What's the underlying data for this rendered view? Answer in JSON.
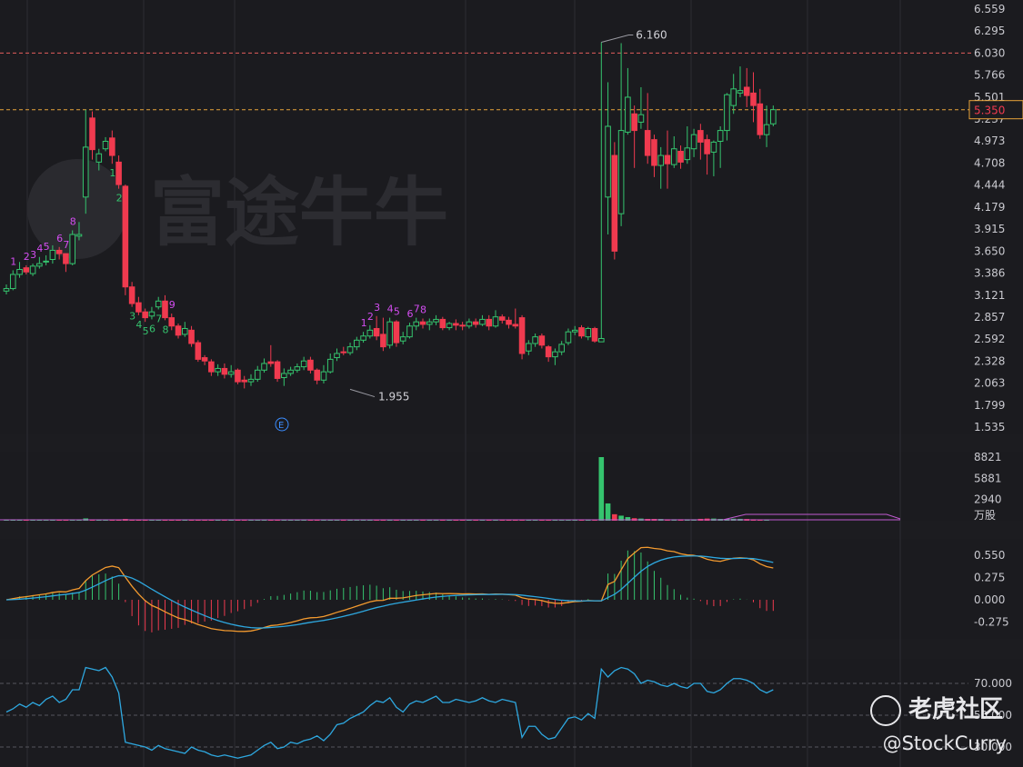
{
  "chart_data": {
    "type": "candlestick",
    "price_axis_ticks": [
      "6.559",
      "6.295",
      "6.030",
      "5.766",
      "5.501",
      "5.237",
      "4.973",
      "4.708",
      "4.444",
      "4.179",
      "3.915",
      "3.650",
      "3.386",
      "3.121",
      "2.857",
      "2.592",
      "2.328",
      "2.063",
      "1.799",
      "1.535"
    ],
    "ylim": [
      1.535,
      6.559
    ],
    "current_price_label": "5.350",
    "high_annotation": "6.160",
    "low_annotation": "1.955",
    "event_marker": "E",
    "resistance_line": 6.03,
    "current_line": 5.35,
    "candles": [
      [
        3.17,
        3.2,
        3.25,
        3.13
      ],
      [
        3.2,
        3.37,
        3.42,
        3.18
      ],
      [
        3.37,
        3.43,
        3.52,
        3.33
      ],
      [
        3.45,
        3.4,
        3.48,
        3.37
      ],
      [
        3.38,
        3.47,
        3.5,
        3.35
      ],
      [
        3.47,
        3.5,
        3.58,
        3.44
      ],
      [
        3.53,
        3.53,
        3.6,
        3.48
      ],
      [
        3.55,
        3.66,
        3.72,
        3.5
      ],
      [
        3.66,
        3.62,
        3.7,
        3.55
      ],
      [
        3.62,
        3.5,
        3.62,
        3.4
      ],
      [
        3.5,
        3.85,
        3.9,
        3.48
      ],
      [
        3.83,
        3.85,
        4.0,
        3.78
      ],
      [
        4.3,
        4.9,
        5.35,
        4.1
      ],
      [
        5.25,
        4.87,
        5.33,
        4.75
      ],
      [
        4.72,
        4.82,
        4.88,
        4.62
      ],
      [
        4.88,
        4.97,
        5.02,
        4.85
      ],
      [
        5.01,
        4.8,
        5.1,
        4.7
      ],
      [
        4.72,
        4.45,
        4.8,
        4.4
      ],
      [
        4.43,
        3.22,
        4.45,
        3.12
      ],
      [
        3.22,
        3.02,
        3.28,
        2.98
      ],
      [
        3.03,
        2.92,
        3.1,
        2.88
      ],
      [
        2.92,
        2.85,
        2.96,
        2.8
      ],
      [
        2.87,
        2.92,
        2.98,
        2.83
      ],
      [
        2.98,
        3.05,
        3.1,
        2.95
      ],
      [
        3.05,
        2.85,
        3.12,
        2.82
      ],
      [
        2.85,
        2.75,
        2.9,
        2.7
      ],
      [
        2.75,
        2.64,
        2.78,
        2.6
      ],
      [
        2.65,
        2.72,
        2.8,
        2.62
      ],
      [
        2.7,
        2.54,
        2.75,
        2.5
      ],
      [
        2.55,
        2.35,
        2.58,
        2.32
      ],
      [
        2.37,
        2.33,
        2.4,
        2.28
      ],
      [
        2.32,
        2.2,
        2.35,
        2.15
      ],
      [
        2.2,
        2.24,
        2.29,
        2.15
      ],
      [
        2.24,
        2.17,
        2.3,
        2.12
      ],
      [
        2.17,
        2.2,
        2.28,
        2.13
      ],
      [
        2.22,
        2.08,
        2.24,
        2.05
      ],
      [
        2.1,
        2.08,
        2.15,
        2.0
      ],
      [
        2.08,
        2.11,
        2.17,
        2.03
      ],
      [
        2.11,
        2.22,
        2.27,
        2.08
      ],
      [
        2.22,
        2.3,
        2.36,
        2.19
      ],
      [
        2.32,
        2.3,
        2.52,
        2.26
      ],
      [
        2.32,
        2.12,
        2.34,
        2.08
      ],
      [
        2.13,
        2.18,
        2.24,
        2.03
      ],
      [
        2.18,
        2.22,
        2.26,
        2.15
      ],
      [
        2.22,
        2.26,
        2.3,
        2.19
      ],
      [
        2.26,
        2.33,
        2.38,
        2.22
      ],
      [
        2.34,
        2.22,
        2.38,
        2.18
      ],
      [
        2.22,
        2.1,
        2.24,
        2.05
      ],
      [
        2.1,
        2.2,
        2.28,
        2.06
      ],
      [
        2.2,
        2.35,
        2.42,
        2.18
      ],
      [
        2.37,
        2.42,
        2.48,
        2.33
      ],
      [
        2.44,
        2.43,
        2.5,
        2.4
      ],
      [
        2.43,
        2.5,
        2.55,
        2.4
      ],
      [
        2.5,
        2.58,
        2.62,
        2.46
      ],
      [
        2.58,
        2.63,
        2.68,
        2.55
      ],
      [
        2.63,
        2.7,
        2.76,
        2.6
      ],
      [
        2.72,
        2.63,
        2.87,
        2.58
      ],
      [
        2.65,
        2.5,
        2.85,
        2.45
      ],
      [
        2.52,
        2.8,
        2.85,
        2.48
      ],
      [
        2.8,
        2.55,
        2.82,
        2.5
      ],
      [
        2.57,
        2.62,
        2.68,
        2.53
      ],
      [
        2.62,
        2.75,
        2.79,
        2.6
      ],
      [
        2.75,
        2.8,
        2.85,
        2.7
      ],
      [
        2.8,
        2.77,
        2.84,
        2.72
      ],
      [
        2.77,
        2.8,
        2.84,
        2.7
      ],
      [
        2.8,
        2.83,
        2.88,
        2.76
      ],
      [
        2.83,
        2.73,
        2.86,
        2.7
      ],
      [
        2.73,
        2.78,
        2.8,
        2.7
      ],
      [
        2.78,
        2.76,
        2.83,
        2.7
      ],
      [
        2.76,
        2.75,
        2.8,
        2.7
      ],
      [
        2.75,
        2.8,
        2.84,
        2.72
      ],
      [
        2.8,
        2.77,
        2.84,
        2.73
      ],
      [
        2.77,
        2.83,
        2.88,
        2.75
      ],
      [
        2.83,
        2.75,
        2.88,
        2.7
      ],
      [
        2.75,
        2.86,
        2.94,
        2.73
      ],
      [
        2.86,
        2.82,
        2.89,
        2.78
      ],
      [
        2.82,
        2.77,
        2.86,
        2.72
      ],
      [
        2.77,
        2.75,
        2.96,
        2.72
      ],
      [
        2.85,
        2.42,
        2.88,
        2.35
      ],
      [
        2.45,
        2.54,
        2.58,
        2.4
      ],
      [
        2.54,
        2.62,
        2.66,
        2.5
      ],
      [
        2.63,
        2.52,
        2.66,
        2.48
      ],
      [
        2.5,
        2.38,
        2.52,
        2.32
      ],
      [
        2.38,
        2.44,
        2.48,
        2.28
      ],
      [
        2.44,
        2.53,
        2.57,
        2.4
      ],
      [
        2.55,
        2.68,
        2.72,
        2.52
      ],
      [
        2.68,
        2.7,
        2.75,
        2.64
      ],
      [
        2.73,
        2.63,
        2.76,
        2.6
      ],
      [
        2.62,
        2.72,
        2.74,
        2.58
      ],
      [
        2.72,
        2.57,
        2.74,
        2.55
      ],
      [
        2.56,
        2.6,
        6.16,
        2.56
      ],
      [
        4.3,
        5.15,
        5.68,
        3.85
      ],
      [
        4.8,
        3.65,
        4.96,
        3.55
      ],
      [
        4.1,
        5.1,
        6.15,
        3.95
      ],
      [
        5.08,
        5.5,
        5.85,
        5.05
      ],
      [
        5.3,
        5.1,
        5.4,
        4.65
      ],
      [
        5.2,
        5.29,
        5.62,
        5.12
      ],
      [
        5.1,
        4.8,
        5.55,
        4.7
      ],
      [
        4.99,
        4.68,
        5.05,
        4.54
      ],
      [
        4.68,
        4.8,
        4.9,
        4.4
      ],
      [
        4.8,
        4.7,
        5.1,
        4.4
      ],
      [
        4.69,
        4.88,
        5.03,
        4.65
      ],
      [
        4.85,
        4.72,
        4.92,
        4.64
      ],
      [
        4.75,
        4.89,
        5.15,
        4.7
      ],
      [
        4.88,
        5.05,
        5.12,
        4.78
      ],
      [
        5.1,
        4.96,
        5.18,
        4.75
      ],
      [
        4.99,
        4.82,
        5.05,
        4.57
      ],
      [
        4.84,
        4.96,
        4.98,
        4.55
      ],
      [
        4.97,
        5.1,
        5.15,
        4.65
      ],
      [
        5.1,
        5.53,
        5.55,
        4.98
      ],
      [
        5.4,
        5.6,
        5.78,
        5.3
      ],
      [
        5.55,
        5.58,
        5.87,
        5.5
      ],
      [
        5.62,
        5.52,
        5.85,
        5.38
      ],
      [
        5.55,
        5.4,
        5.8,
        5.2
      ],
      [
        5.42,
        5.05,
        5.6,
        5.0
      ],
      [
        5.05,
        5.17,
        5.4,
        4.9
      ],
      [
        5.18,
        5.35,
        5.4,
        5.15
      ]
    ],
    "td_labels": [
      {
        "i": 1,
        "t": "1",
        "c": "m"
      },
      {
        "i": 3,
        "t": "2",
        "c": "m"
      },
      {
        "i": 4,
        "t": "3",
        "c": "m"
      },
      {
        "i": 5,
        "t": "4",
        "c": "m"
      },
      {
        "i": 6,
        "t": "5",
        "c": "m"
      },
      {
        "i": 8,
        "t": "6",
        "c": "m"
      },
      {
        "i": 9,
        "t": "7",
        "c": "m"
      },
      {
        "i": 10,
        "t": "8",
        "c": "m"
      },
      {
        "i": 16,
        "t": "1",
        "c": "g"
      },
      {
        "i": 17,
        "t": "2",
        "c": "g"
      },
      {
        "i": 19,
        "t": "3",
        "c": "g"
      },
      {
        "i": 20,
        "t": "4",
        "c": "g"
      },
      {
        "i": 21,
        "t": "5",
        "c": "g"
      },
      {
        "i": 22,
        "t": "6",
        "c": "g"
      },
      {
        "i": 23,
        "t": "7",
        "c": "g"
      },
      {
        "i": 24,
        "t": "8",
        "c": "g"
      },
      {
        "i": 25,
        "t": "9",
        "c": "m"
      },
      {
        "i": 54,
        "t": "1",
        "c": "m"
      },
      {
        "i": 55,
        "t": "2",
        "c": "m"
      },
      {
        "i": 56,
        "t": "3",
        "c": "m"
      },
      {
        "i": 58,
        "t": "4",
        "c": "m"
      },
      {
        "i": 59,
        "t": "5",
        "c": "m"
      },
      {
        "i": 61,
        "t": "6",
        "c": "m"
      },
      {
        "i": 62,
        "t": "7",
        "c": "m"
      },
      {
        "i": 63,
        "t": "8",
        "c": "m"
      }
    ],
    "volume_axis_ticks": [
      "8821",
      "5881",
      "2940"
    ],
    "volume_unit": "万股",
    "volume": [
      60,
      40,
      30,
      30,
      30,
      30,
      40,
      50,
      40,
      40,
      60,
      60,
      320,
      180,
      60,
      50,
      60,
      60,
      240,
      80,
      60,
      50,
      40,
      50,
      40,
      40,
      40,
      40,
      50,
      50,
      40,
      40,
      30,
      30,
      30,
      40,
      30,
      30,
      40,
      40,
      60,
      40,
      40,
      40,
      40,
      40,
      40,
      40,
      40,
      50,
      40,
      40,
      40,
      40,
      40,
      40,
      40,
      40,
      40,
      40,
      40,
      40,
      40,
      40,
      40,
      40,
      40,
      40,
      40,
      40,
      40,
      40,
      40,
      40,
      40,
      40,
      40,
      40,
      150,
      40,
      40,
      40,
      40,
      40,
      40,
      40,
      40,
      40,
      40,
      40,
      8821,
      2400,
      900,
      700,
      500,
      350,
      300,
      250,
      250,
      240,
      200,
      200,
      200,
      200,
      200,
      260,
      300,
      300,
      250,
      250,
      280,
      260,
      240,
      200,
      180,
      150
    ],
    "macd_axis_ticks": [
      "0.550",
      "0.275",
      "0.000",
      "-0.275"
    ],
    "rsi_axis_ticks": [
      "70.000",
      "50.000",
      "30.000"
    ],
    "rsi": [
      52,
      54,
      57,
      55,
      58,
      56,
      60,
      62,
      58,
      60,
      66,
      66,
      80,
      79,
      78,
      80,
      74,
      64,
      33,
      32,
      31,
      30,
      28,
      31,
      29,
      28,
      27,
      26,
      30,
      28,
      27,
      25,
      24,
      25,
      24,
      23,
      24,
      25,
      28,
      31,
      33,
      29,
      30,
      33,
      32,
      34,
      35,
      37,
      34,
      38,
      44,
      45,
      48,
      50,
      52,
      56,
      59,
      58,
      61,
      55,
      52,
      57,
      59,
      58,
      60,
      62,
      58,
      58,
      60,
      59,
      58,
      59,
      61,
      59,
      58,
      60,
      59,
      58,
      36,
      43,
      43,
      38,
      35,
      36,
      42,
      48,
      49,
      47,
      51,
      48,
      79,
      74,
      78,
      80,
      79,
      76,
      70,
      72,
      71,
      69,
      68,
      70,
      68,
      67,
      70,
      70,
      65,
      64,
      66,
      70,
      73,
      73,
      72,
      70,
      66,
      64,
      66
    ]
  },
  "watermark": {
    "brand": "老虎社区",
    "handle": "@StockCurry",
    "logo_text": "富途牛牛"
  }
}
